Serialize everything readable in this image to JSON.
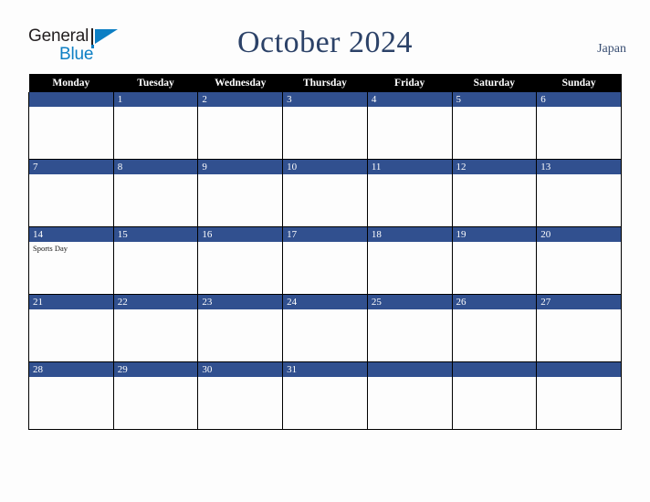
{
  "brand": {
    "name_part1": "General",
    "name_part2": "Blue",
    "mark_icon": "triangle-flag-icon",
    "color_dark": "#231f20",
    "color_blue": "#0d7fc4"
  },
  "header": {
    "title": "October 2024",
    "country": "Japan",
    "title_color": "#2c4268"
  },
  "calendar": {
    "accent_color": "#31508f",
    "header_bg": "#000000",
    "weekday_headers": [
      "Monday",
      "Tuesday",
      "Wednesday",
      "Thursday",
      "Friday",
      "Saturday",
      "Sunday"
    ],
    "weeks": [
      [
        {
          "day": "",
          "events": []
        },
        {
          "day": "1",
          "events": []
        },
        {
          "day": "2",
          "events": []
        },
        {
          "day": "3",
          "events": []
        },
        {
          "day": "4",
          "events": []
        },
        {
          "day": "5",
          "events": []
        },
        {
          "day": "6",
          "events": []
        }
      ],
      [
        {
          "day": "7",
          "events": []
        },
        {
          "day": "8",
          "events": []
        },
        {
          "day": "9",
          "events": []
        },
        {
          "day": "10",
          "events": []
        },
        {
          "day": "11",
          "events": []
        },
        {
          "day": "12",
          "events": []
        },
        {
          "day": "13",
          "events": []
        }
      ],
      [
        {
          "day": "14",
          "events": [
            "Sports Day"
          ]
        },
        {
          "day": "15",
          "events": []
        },
        {
          "day": "16",
          "events": []
        },
        {
          "day": "17",
          "events": []
        },
        {
          "day": "18",
          "events": []
        },
        {
          "day": "19",
          "events": []
        },
        {
          "day": "20",
          "events": []
        }
      ],
      [
        {
          "day": "21",
          "events": []
        },
        {
          "day": "22",
          "events": []
        },
        {
          "day": "23",
          "events": []
        },
        {
          "day": "24",
          "events": []
        },
        {
          "day": "25",
          "events": []
        },
        {
          "day": "26",
          "events": []
        },
        {
          "day": "27",
          "events": []
        }
      ],
      [
        {
          "day": "28",
          "events": []
        },
        {
          "day": "29",
          "events": []
        },
        {
          "day": "30",
          "events": []
        },
        {
          "day": "31",
          "events": []
        },
        {
          "day": "",
          "events": []
        },
        {
          "day": "",
          "events": []
        },
        {
          "day": "",
          "events": []
        }
      ]
    ]
  }
}
